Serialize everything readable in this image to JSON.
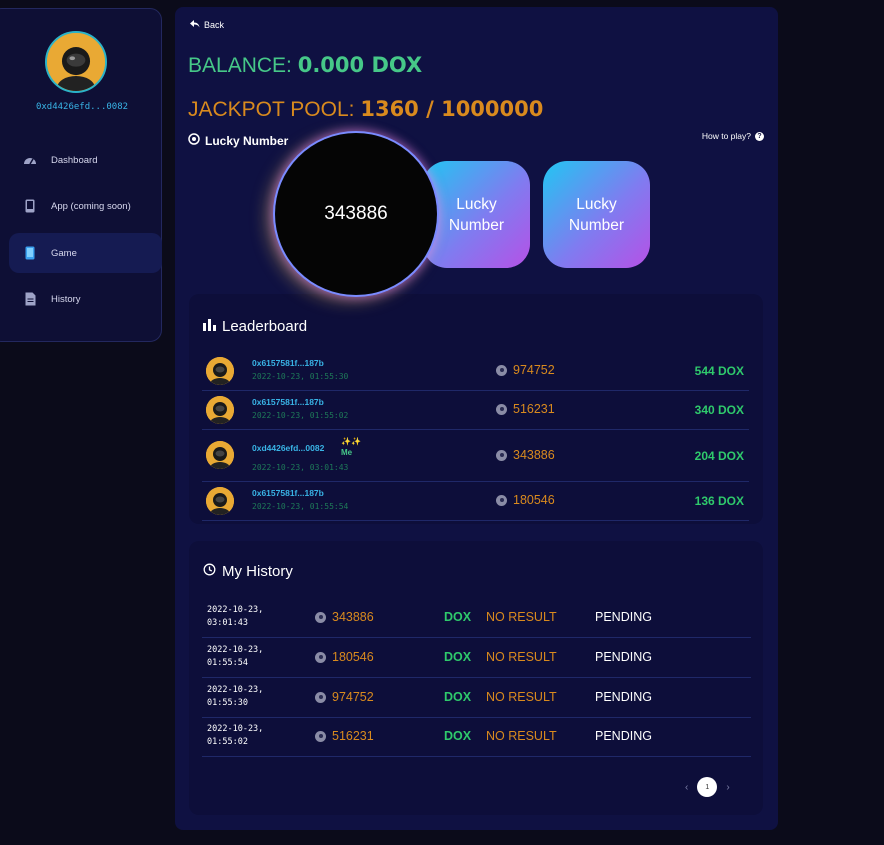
{
  "sidebar": {
    "wallet": "0xd4426efd...0082",
    "items": [
      {
        "label": "Dashboard",
        "icon": "speedometer-icon"
      },
      {
        "label": "App (coming soon)",
        "icon": "tablet-icon"
      },
      {
        "label": "Game",
        "icon": "phone-icon",
        "active": true
      },
      {
        "label": "History",
        "icon": "document-icon"
      }
    ]
  },
  "header": {
    "back_label": "Back",
    "balance_label": "BALANCE:",
    "balance_value": "0.000 DOX",
    "jackpot_label": "JACKPOT POOL:",
    "jackpot_value": "1360 / 1000000"
  },
  "lucky": {
    "title": "Lucky Number",
    "how_to_play": "How to play?",
    "current_number": "343886",
    "buttons": [
      "Lucky\nNumber",
      "Lucky\nNumber"
    ]
  },
  "leaderboard": {
    "title": "Leaderboard",
    "rows": [
      {
        "address": "0x6157581f...187b",
        "date": "2022-10-23, 01:55:30",
        "number": "974752",
        "amount": "544 DOX",
        "me": false
      },
      {
        "address": "0x6157581f...187b",
        "date": "2022-10-23, 01:55:02",
        "number": "516231",
        "amount": "340 DOX",
        "me": false
      },
      {
        "address": "0xd4426efd...0082",
        "date": "2022-10-23, 03:01:43",
        "number": "343886",
        "amount": "204 DOX",
        "me": true,
        "me_sparkles": "✨✨",
        "me_label": "Me"
      },
      {
        "address": "0x6157581f...187b",
        "date": "2022-10-23, 01:55:54",
        "number": "180546",
        "amount": "136 DOX",
        "me": false
      }
    ]
  },
  "history": {
    "title": "My History",
    "rows": [
      {
        "date": "2022-10-23,\n03:01:43",
        "number": "343886",
        "currency": "DOX",
        "result": "NO RESULT",
        "status": "PENDING"
      },
      {
        "date": "2022-10-23,\n01:55:54",
        "number": "180546",
        "currency": "DOX",
        "result": "NO RESULT",
        "status": "PENDING"
      },
      {
        "date": "2022-10-23,\n01:55:30",
        "number": "974752",
        "currency": "DOX",
        "result": "NO RESULT",
        "status": "PENDING"
      },
      {
        "date": "2022-10-23,\n01:55:02",
        "number": "516231",
        "currency": "DOX",
        "result": "NO RESULT",
        "status": "PENDING"
      }
    ]
  },
  "pagination": {
    "prev": "‹",
    "page": "1",
    "next": "›"
  },
  "colors": {
    "balance": "#46c888",
    "jackpot": "#d98a1e",
    "accent": "#39b4e6",
    "panel": "#0f1142"
  }
}
